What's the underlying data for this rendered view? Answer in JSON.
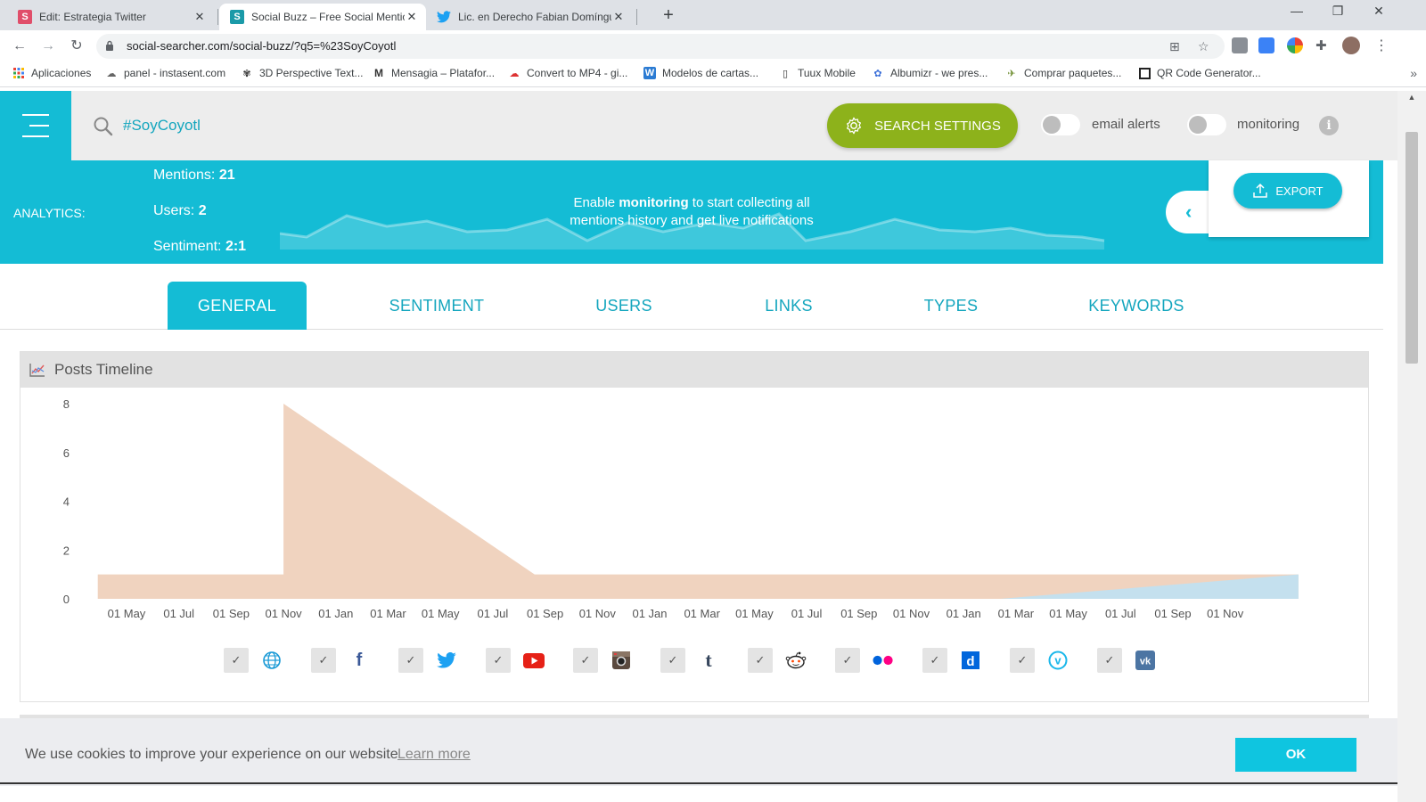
{
  "browser": {
    "tabs": [
      {
        "title": "Edit: Estrategia Twitter",
        "favicon_letter": "S",
        "favicon_color": "#e04e6a",
        "active": false
      },
      {
        "title": "Social Buzz – Free Social Mention",
        "favicon_letter": "S",
        "favicon_color": "#1a9aa8",
        "active": true
      },
      {
        "title": "Lic. en Derecho Fabian Domíngue",
        "favicon_letter": "",
        "favicon_color": "#1da1f2",
        "active": false
      }
    ],
    "new_tab": "+",
    "url": "social-searcher.com/social-buzz/?q5=%23SoyCoyotl",
    "bookmarks": [
      {
        "label": "Aplicaciones",
        "icon": "apps-grid-icon"
      },
      {
        "label": "panel - instasent.com",
        "icon": "instasent-icon"
      },
      {
        "label": "3D Perspective Text...",
        "icon": "bow-icon"
      },
      {
        "label": "Mensagia – Platafor...",
        "icon": "mensagia-icon"
      },
      {
        "label": "Convert to MP4 - gi...",
        "icon": "cloud-icon"
      },
      {
        "label": "Modelos de cartas...",
        "icon": "word-icon"
      },
      {
        "label": "Tuux Mobile",
        "icon": "phone-icon"
      },
      {
        "label": "Albumizr - we pres...",
        "icon": "albumizr-icon"
      },
      {
        "label": "Comprar paquetes...",
        "icon": "plane-icon"
      },
      {
        "label": "QR Code Generator...",
        "icon": "qr-icon"
      }
    ]
  },
  "header": {
    "search_term": "#SoyCoyotl",
    "settings_label": "SEARCH SETTINGS",
    "email_alerts_label": "email alerts",
    "monitoring_label": "monitoring",
    "info_glyph": "i"
  },
  "analytics": {
    "label": "ANALYTICS:",
    "mentions_label": "Mentions:",
    "mentions_value": "21",
    "users_label": "Users:",
    "users_value": "2",
    "sentiment_label": "Sentiment:",
    "sentiment_value": "2:1",
    "monitor_pre": "Enable ",
    "monitor_bold": "monitoring",
    "monitor_post": " to start collecting all mentions history and get live notifications",
    "export_label": "EXPORT"
  },
  "tabs": [
    "GENERAL",
    "SENTIMENT",
    "USERS",
    "LINKS",
    "TYPES",
    "KEYWORDS"
  ],
  "active_tab": "GENERAL",
  "panel": {
    "title": "Posts Timeline"
  },
  "chart_data": {
    "type": "area",
    "x": [
      "01 May",
      "01 Jul",
      "01 Sep",
      "01 Nov",
      "01 Jan",
      "01 Mar",
      "01 May",
      "01 Jul",
      "01 Sep",
      "01 Nov",
      "01 Jan",
      "01 Mar",
      "01 May",
      "01 Jul",
      "01 Sep",
      "01 Nov",
      "01 Jan",
      "01 Mar",
      "01 May",
      "01 Jul",
      "01 Sep",
      "01 Nov"
    ],
    "y_ticks": [
      0,
      2,
      4,
      6,
      8
    ],
    "ylim": [
      0,
      8
    ],
    "series": [
      {
        "color": "#f0d3bf",
        "points": [
          [
            -0.55,
            1
          ],
          [
            3.0,
            1
          ],
          [
            3.0,
            8
          ],
          [
            7.8,
            1
          ],
          [
            22.4,
            1
          ],
          [
            22.4,
            0
          ]
        ]
      },
      {
        "color": "#c4e0ee",
        "points": [
          [
            16.7,
            0
          ],
          [
            22.4,
            1
          ],
          [
            22.4,
            0
          ]
        ]
      }
    ]
  },
  "sources": [
    {
      "name": "web",
      "icon": "globe-icon",
      "checked": true
    },
    {
      "name": "facebook",
      "icon": "facebook-icon",
      "checked": true
    },
    {
      "name": "twitter",
      "icon": "twitter-icon",
      "checked": true
    },
    {
      "name": "youtube",
      "icon": "youtube-icon",
      "checked": true
    },
    {
      "name": "instagram",
      "icon": "instagram-icon",
      "checked": true
    },
    {
      "name": "tumblr",
      "icon": "tumblr-icon",
      "checked": true
    },
    {
      "name": "reddit",
      "icon": "reddit-icon",
      "checked": true
    },
    {
      "name": "flickr",
      "icon": "flickr-icon",
      "checked": true
    },
    {
      "name": "dailymotion",
      "icon": "dailymotion-icon",
      "checked": true
    },
    {
      "name": "vimeo",
      "icon": "vimeo-icon",
      "checked": true
    },
    {
      "name": "vk",
      "icon": "vk-icon",
      "checked": true
    }
  ],
  "checkmark": "✓",
  "cookie": {
    "message": "We use cookies to improve your experience on our website",
    "learn_more": "Learn more",
    "ok_label": "OK"
  },
  "colors": {
    "brand": "#14bcd5",
    "settings_green": "#8db21b",
    "chart_peach": "#f0d3bf",
    "chart_blue": "#c4e0ee"
  }
}
